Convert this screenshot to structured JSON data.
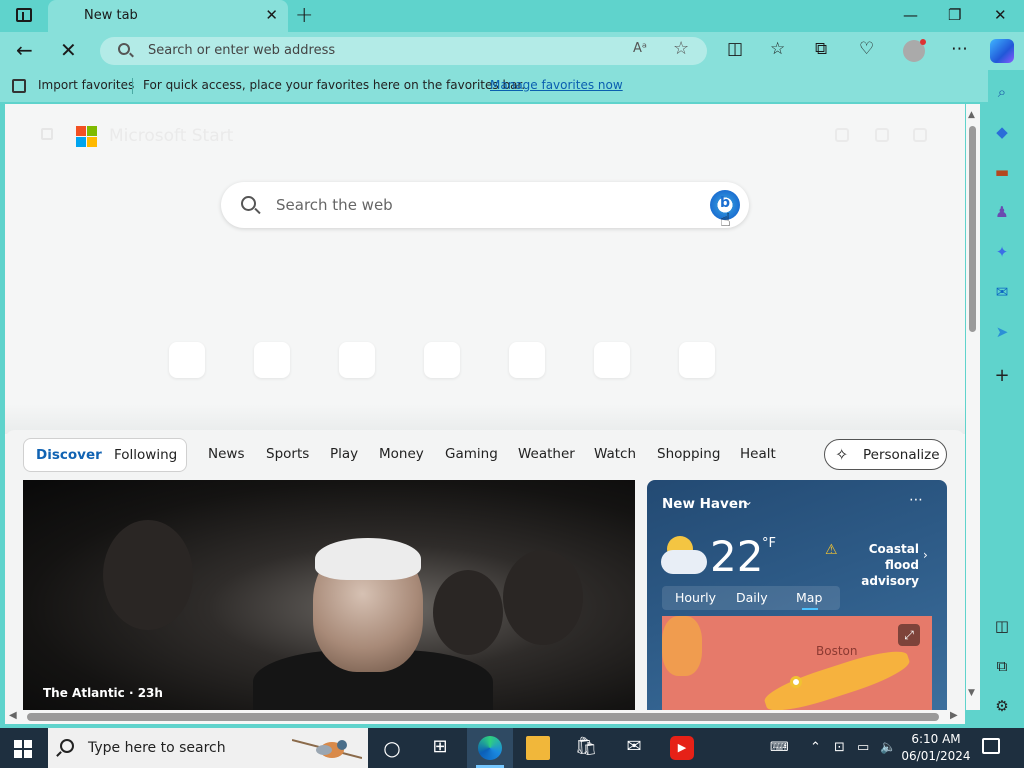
{
  "browser": {
    "tab_title": "New tab",
    "address_placeholder": "Search or enter web address"
  },
  "favorites_bar": {
    "import_label": "Import favorites",
    "tip": "For quick access, place your favorites here on the favorites bar.",
    "manage_link": "Manage favorites now"
  },
  "newtab": {
    "search_placeholder": "Search the web",
    "brand": "Microsoft Start"
  },
  "feed": {
    "pills": [
      "Discover",
      "Following"
    ],
    "active_pill": "Discover",
    "categories": [
      "News",
      "Sports",
      "Play",
      "Money",
      "Gaming",
      "Weather",
      "Watch",
      "Shopping",
      "Healt"
    ],
    "personalize_label": "Personalize",
    "top_story_source": "The Atlantic · 23h"
  },
  "weather": {
    "location": "New Haven",
    "temperature": "22",
    "unit": "°F",
    "alert": "Coastal flood advisory",
    "tabs": [
      "Hourly",
      "Daily",
      "Map"
    ],
    "active_tab": "Map",
    "map_city": "Boston"
  },
  "taskbar": {
    "search_placeholder": "Type here to search",
    "time": "6:10 AM",
    "date": "06/01/2024"
  },
  "icons": {
    "sidebar": [
      "search-icon",
      "shopping-tag-icon",
      "toolbox-icon",
      "games-icon",
      "copilot-icon",
      "outlook-icon",
      "telegram-icon",
      "add-icon",
      "split-panel-icon",
      "open-external-icon",
      "settings-icon"
    ]
  },
  "colors": {
    "frame": "#5fd3cc",
    "accent_link": "#0a5fb0",
    "discover_active": "#1163b3"
  }
}
